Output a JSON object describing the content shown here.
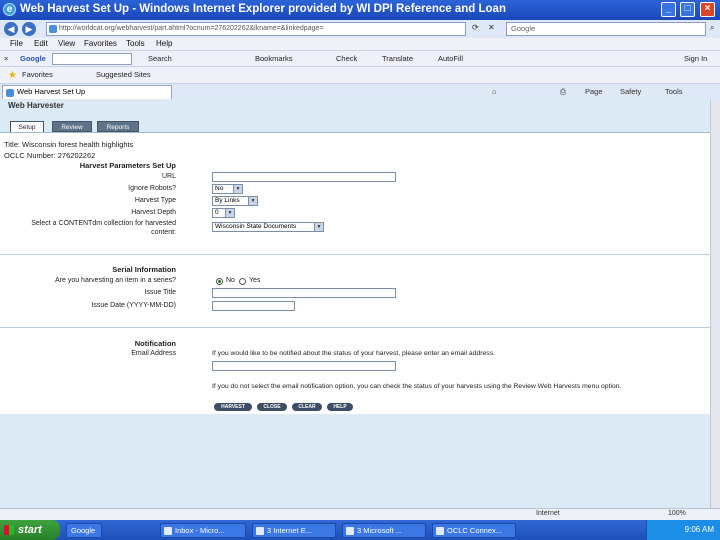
{
  "window": {
    "title": "Web Harvest Set Up - Windows Internet Explorer provided by WI DPI Reference and Loan"
  },
  "address": {
    "url": "http://worldcat.org/webharvest/part.ahtml?ocnum=276202262&lkname=&linkedpage=",
    "search_placeholder": "Google"
  },
  "menubar": [
    "File",
    "Edit",
    "View",
    "Favorites",
    "Tools",
    "Help"
  ],
  "google_toolbar": {
    "label": "Google",
    "search": "Search",
    "bookmarks": "Bookmarks",
    "check": "Check",
    "translate": "Translate",
    "autofill": "AutoFill",
    "signin": "Sign In"
  },
  "favorites": {
    "label": "Favorites",
    "suggested": "Suggested Sites"
  },
  "tab": {
    "label": "Web Harvest Set Up"
  },
  "commands": {
    "page": "Page",
    "safety": "Safety",
    "tools": "Tools"
  },
  "app": {
    "title": "Web Harvester",
    "tabs": [
      "Setup",
      "Review",
      "Reports"
    ],
    "item_title": "Title: Wisconsin forest health highlights",
    "ocln": "OCLC Number: 276202262"
  },
  "harvest": {
    "heading": "Harvest Parameters Set Up",
    "url_label": "URL",
    "ignore_label": "Ignore Robots?",
    "ignore_value": "No",
    "type_label": "Harvest Type",
    "type_value": "By Links",
    "depth_label": "Harvest Depth",
    "depth_value": "0",
    "collection_label_1": "Select a CONTENTdm collection for harvested",
    "collection_label_2": "content:",
    "collection_value": "Wisconsin State Documents"
  },
  "serial": {
    "heading": "Serial Information",
    "question": "Are you harvesting an item in a series?",
    "no": "No",
    "yes": "Yes",
    "issue_title_label": "Issue Title",
    "issue_date_label": "Issue Date (YYYY-MM-DD)"
  },
  "notification": {
    "heading": "Notification",
    "email_label": "Email Address",
    "note1": "If you would like to be notified about the status of your harvest, please enter an email address.",
    "note2": "If you do not select the email notification option, you can check the status of your harvests using the Review Web Harvests menu option."
  },
  "buttons": {
    "harvest": "HARVEST",
    "close": "CLOSE",
    "clear": "CLEAR",
    "help": "HELP"
  },
  "status": {
    "zone": "Internet",
    "zoom": "100%"
  },
  "taskbar": {
    "start": "start",
    "google": "Google",
    "items": [
      "Inbox - Micro...",
      "3 Internet E...",
      "3 Microsoft ...",
      "OCLC Connex..."
    ],
    "clock": "9:06 AM"
  }
}
